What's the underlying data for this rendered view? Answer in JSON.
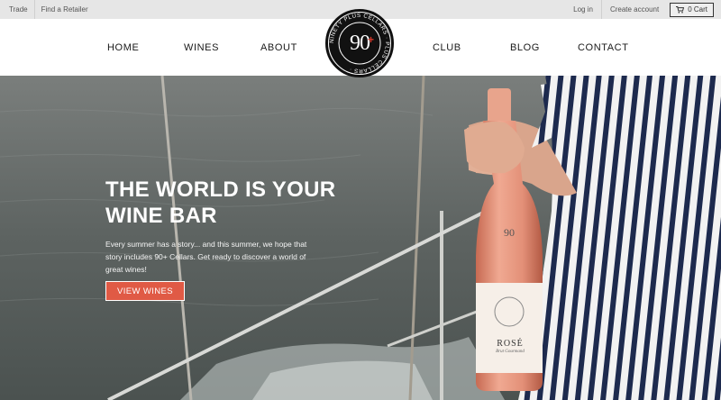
{
  "topbar": {
    "trade": "Trade",
    "find_retailer": "Find a Retailer",
    "login": "Log in",
    "create_account": "Create account",
    "cart": "0 Cart"
  },
  "nav": {
    "home": "HOME",
    "wines": "WINES",
    "about": "ABOUT",
    "club": "CLUB",
    "blog": "BLOG",
    "contact": "CONTACT"
  },
  "logo": {
    "number": "90",
    "plus": "+",
    "ring_text": "NINETY PLUS CELLARS · PLUS CELLARS ·"
  },
  "hero": {
    "title_line1": "THE WORLD IS YOUR",
    "title_line2": "WINE BAR",
    "text": "Every summer has a story... and this summer, we hope that story includes 90+ Cellars. Get ready to discover a world of great wines!",
    "button": "VIEW WINES",
    "bottle_label_number": "90",
    "bottle_label_name": "ROSÉ",
    "bottle_label_sub": "Brut Gourmand"
  },
  "colors": {
    "accent": "#e05a45",
    "topbar_bg": "#e6e6e6",
    "logo_plus": "#d6382b"
  }
}
